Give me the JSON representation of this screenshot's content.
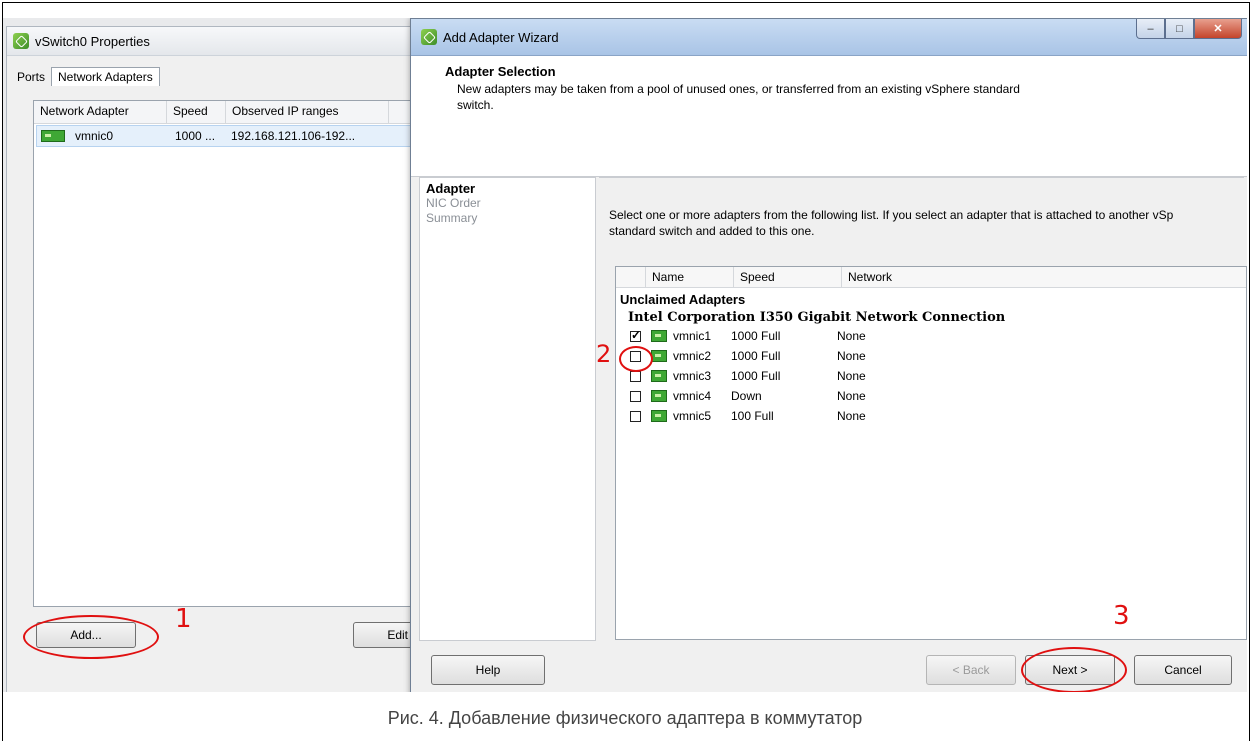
{
  "back_window": {
    "title": "vSwitch0 Properties",
    "tabs": [
      "Ports",
      "Network Adapters"
    ],
    "columns": [
      "Network Adapter",
      "Speed",
      "Observed IP ranges"
    ],
    "rows": [
      {
        "adapter": "vmnic0",
        "speed": "1000 ...",
        "ip": "192.168.121.106-192..."
      }
    ],
    "add_label": "Add...",
    "edit_label": "Edit"
  },
  "wizard": {
    "title": "Add Adapter Wizard",
    "header_title": "Adapter Selection",
    "header_desc_1": "New adapters may be taken from a pool of unused ones, or transferred from an existing vSphere standard",
    "header_desc_2": "switch.",
    "steps": [
      "Adapter",
      "NIC Order",
      "Summary"
    ],
    "instruction_1": "Select one or more adapters from the following list. If you select an adapter that is attached to another vSp",
    "instruction_2": "standard switch and added to this one.",
    "columns": [
      "Name",
      "Speed",
      "Network"
    ],
    "group_label": "Unclaimed Adapters",
    "vendor_label": "Intel Corporation I350 Gigabit Network Connection",
    "adapters": [
      {
        "name": "vmnic1",
        "speed": "1000 Full",
        "network": "None",
        "checked": true
      },
      {
        "name": "vmnic2",
        "speed": "1000 Full",
        "network": "None",
        "checked": false
      },
      {
        "name": "vmnic3",
        "speed": "1000 Full",
        "network": "None",
        "checked": false
      },
      {
        "name": "vmnic4",
        "speed": "Down",
        "network": "None",
        "checked": false
      },
      {
        "name": "vmnic5",
        "speed": "100 Full",
        "network": "None",
        "checked": false
      }
    ],
    "help_label": "Help",
    "back_label": "< Back",
    "next_label": "Next >",
    "cancel_label": "Cancel"
  },
  "annotations": [
    "1",
    "2",
    "3"
  ],
  "annotation_color": "#e01010",
  "caption": "Рис. 4. Добавление физического адаптера в коммутатор"
}
